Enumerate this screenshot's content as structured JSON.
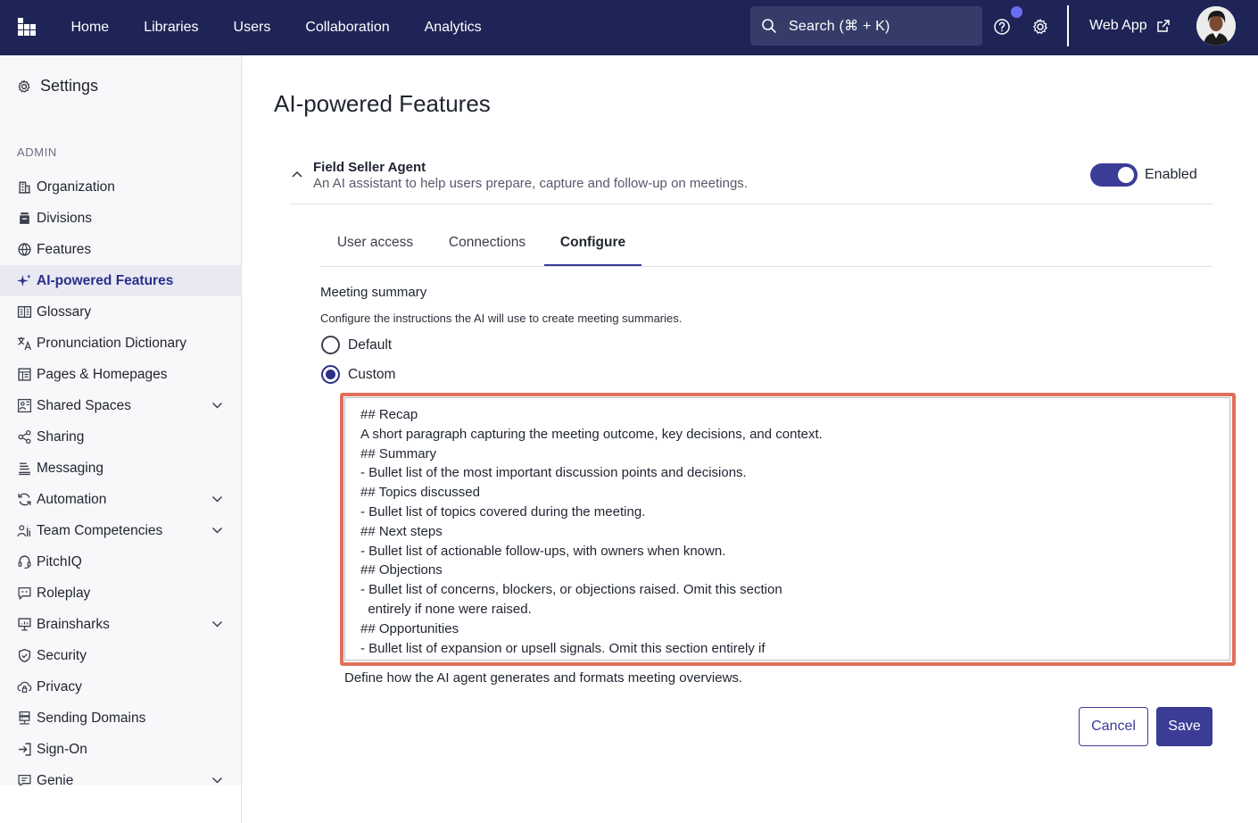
{
  "nav": {
    "items": [
      "Home",
      "Libraries",
      "Users",
      "Collaboration",
      "Analytics"
    ],
    "search_label": "Search (⌘ + K)",
    "web_app_label": "Web App"
  },
  "sidebar": {
    "title": "Settings",
    "section_label": "ADMIN",
    "items": [
      {
        "label": "Organization",
        "icon": "building-icon"
      },
      {
        "label": "Divisions",
        "icon": "divisions-icon"
      },
      {
        "label": "Features",
        "icon": "features-icon"
      },
      {
        "label": "AI-powered Features",
        "icon": "sparkle-icon",
        "active": true
      },
      {
        "label": "Glossary",
        "icon": "glossary-icon"
      },
      {
        "label": "Pronunciation Dictionary",
        "icon": "translate-icon"
      },
      {
        "label": "Pages & Homepages",
        "icon": "pages-icon"
      },
      {
        "label": "Shared Spaces",
        "icon": "shared-spaces-icon",
        "expandable": true
      },
      {
        "label": "Sharing",
        "icon": "share-icon"
      },
      {
        "label": "Messaging",
        "icon": "messaging-icon"
      },
      {
        "label": "Automation",
        "icon": "automation-icon",
        "expandable": true
      },
      {
        "label": "Team Competencies",
        "icon": "team-icon",
        "expandable": true
      },
      {
        "label": "PitchIQ",
        "icon": "headset-icon"
      },
      {
        "label": "Roleplay",
        "icon": "roleplay-icon"
      },
      {
        "label": "Brainsharks",
        "icon": "presentation-icon",
        "expandable": true
      },
      {
        "label": "Security",
        "icon": "shield-icon"
      },
      {
        "label": "Privacy",
        "icon": "cloud-lock-icon"
      },
      {
        "label": "Sending Domains",
        "icon": "server-icon"
      },
      {
        "label": "Sign-On",
        "icon": "sign-in-icon"
      },
      {
        "label": "Genie",
        "icon": "chat-icon",
        "expandable": true
      }
    ]
  },
  "main": {
    "page_title": "AI-powered Features",
    "agent": {
      "title": "Field Seller Agent",
      "description": "An AI assistant to help users prepare, capture and follow-up on meetings.",
      "toggle_label": "Enabled",
      "enabled": true
    },
    "tabs": [
      "User access",
      "Connections",
      "Configure"
    ],
    "active_tab": "Configure",
    "meeting_summary": {
      "title": "Meeting summary",
      "description": "Configure the instructions the AI will use to create meeting summaries.",
      "option_default": "Default",
      "option_custom": "Custom",
      "selected": "Custom",
      "instructions": "## Recap\nA short paragraph capturing the meeting outcome, key decisions, and context.\n## Summary\n- Bullet list of the most important discussion points and decisions.\n## Topics discussed\n- Bullet list of topics covered during the meeting.\n## Next steps\n- Bullet list of actionable follow-ups, with owners when known.\n## Objections\n- Bullet list of concerns, blockers, or objections raised. Omit this section\n  entirely if none were raised.\n## Opportunities\n- Bullet list of expansion or upsell signals. Omit this section entirely if",
      "helper_text": "Define how the AI agent generates and formats meeting overviews."
    },
    "cancel_label": "Cancel",
    "save_label": "Save"
  },
  "colors": {
    "nav_bg": "#1e2456",
    "accent": "#3a3c96",
    "highlight": "#e0705a",
    "notification": "#6b6cf5"
  }
}
